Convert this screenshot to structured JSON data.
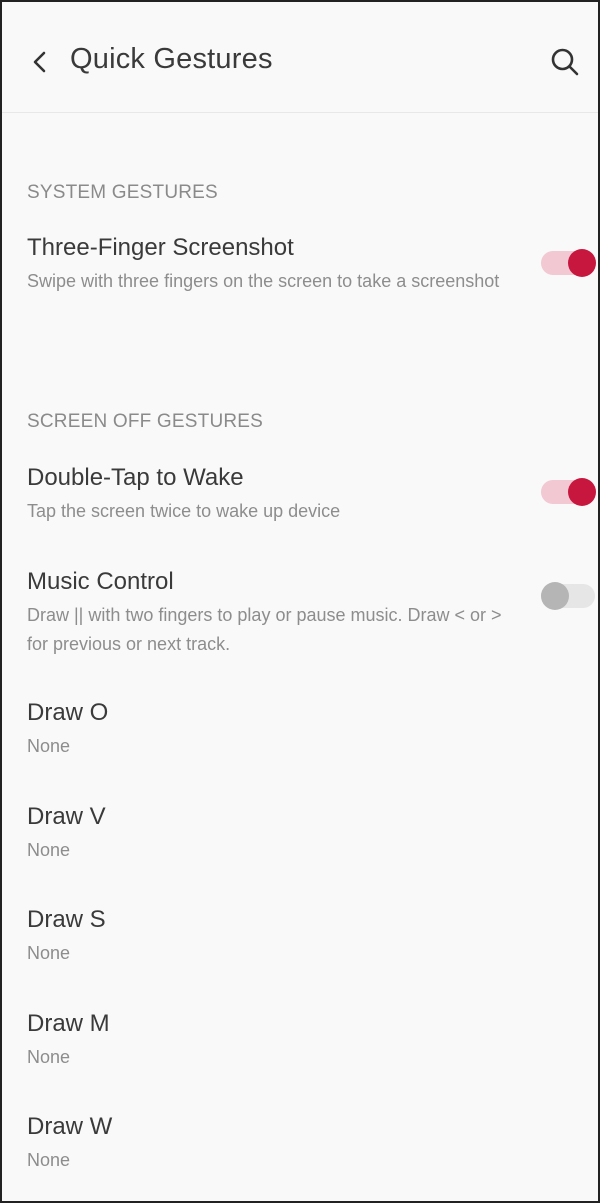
{
  "header": {
    "title": "Quick Gestures",
    "back_icon": "chevron-left-icon",
    "search_icon": "search-icon"
  },
  "colors": {
    "accent": "#c8173f",
    "accent_track": "#f2c8d3",
    "off_thumb": "#b5b5b5",
    "off_track": "#e6e6e6"
  },
  "sections": {
    "system": {
      "header": "SYSTEM GESTURES",
      "three_finger": {
        "title": "Three-Finger Screenshot",
        "summary": "Swipe with three fingers on the screen to take a screenshot",
        "enabled": true
      }
    },
    "screen_off": {
      "header": "SCREEN OFF GESTURES",
      "double_tap": {
        "title": "Double-Tap to Wake",
        "summary": "Tap the screen twice to wake up device",
        "enabled": true
      },
      "music_control": {
        "title": "Music Control",
        "summary": "Draw || with two fingers to play or pause music. Draw < or > for previous or next track.",
        "enabled": false
      },
      "draw_items": [
        {
          "title": "Draw O",
          "value": "None"
        },
        {
          "title": "Draw V",
          "value": "None"
        },
        {
          "title": "Draw S",
          "value": "None"
        },
        {
          "title": "Draw M",
          "value": "None"
        },
        {
          "title": "Draw W",
          "value": "None"
        }
      ]
    }
  }
}
